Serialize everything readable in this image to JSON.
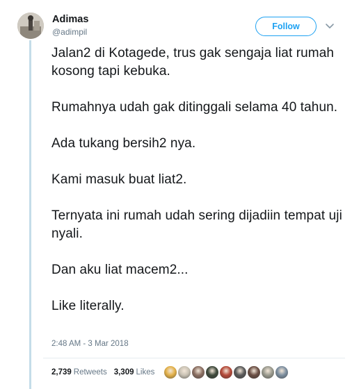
{
  "author": {
    "name": "Adimas",
    "handle": "@adimpil"
  },
  "follow_label": "Follow",
  "tweet": {
    "paragraphs": [
      "Jalan2 di Kotagede, trus gak sengaja liat rumah kosong tapi kebuka.",
      "Rumahnya udah gak ditinggali selama 40 tahun.",
      "Ada tukang bersih2 nya.",
      "Kami masuk buat liat2.",
      "Ternyata ini rumah udah sering dijadiin tempat uji nyali.",
      "Dan aku liat macem2...",
      "Like literally."
    ],
    "timestamp": "2:48 AM - 3 Mar 2018"
  },
  "stats": {
    "retweets_count": "2,739",
    "retweets_label": "Retweets",
    "likes_count": "3,309",
    "likes_label": "Likes"
  },
  "colors": {
    "accent": "#1da1f2",
    "thread_line": "#c4dde9",
    "muted_text": "#657786"
  },
  "likers": [
    {
      "icon": "liker-avatar",
      "color": "#e3b14a"
    },
    {
      "icon": "liker-avatar",
      "color": "#c9c2b4"
    },
    {
      "icon": "liker-avatar",
      "color": "#8b6f62"
    },
    {
      "icon": "liker-avatar",
      "color": "#3f4a3c"
    },
    {
      "icon": "liker-avatar",
      "color": "#b54a3a"
    },
    {
      "icon": "liker-avatar",
      "color": "#5a5a5a"
    },
    {
      "icon": "liker-avatar",
      "color": "#6b4f44"
    },
    {
      "icon": "liker-avatar",
      "color": "#9a9a8e"
    },
    {
      "icon": "liker-avatar",
      "color": "#7d8fa0"
    }
  ]
}
